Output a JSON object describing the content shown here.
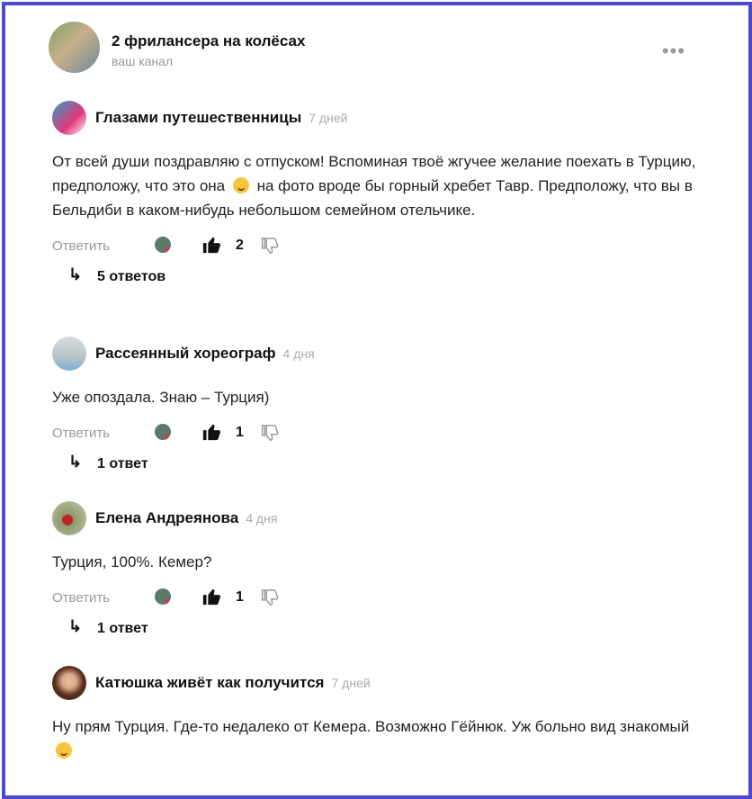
{
  "channel": {
    "title": "2 фрилансера на колёсах",
    "subtitle": "ваш канал",
    "more_icon": "more-dots-icon"
  },
  "ui": {
    "reply_label": "Ответить"
  },
  "comments": [
    {
      "author": "Глазами путешественницы",
      "time": "7 дней",
      "text_1": "От всей души поздравляю с отпуском! Вспоминая твоё жгучее желание поехать в Турцию, предположу, что это она",
      "text_2": " на фото вроде бы горный хребет Тавр. Предположу, что вы в Бельдиби в каком-нибудь небольшом семейном отельчике.",
      "likes": "2",
      "replies": "5 ответов"
    },
    {
      "author": "Рассеянный хореограф",
      "time": "4 дня",
      "text": "Уже опоздала. Знаю – Турция)",
      "likes": "1",
      "replies": "1 ответ"
    },
    {
      "author": "Елена Андреянова",
      "time": "4 дня",
      "text": "Турция, 100%. Кемер?",
      "likes": "1",
      "replies": "1 ответ"
    },
    {
      "author": "Катюшка живёт как получится",
      "time": "7 дней",
      "text": "Ну прям Турция. Где-то недалеко от Кемера. Возможно Гёйнюк. Уж больно вид знакомый"
    }
  ]
}
